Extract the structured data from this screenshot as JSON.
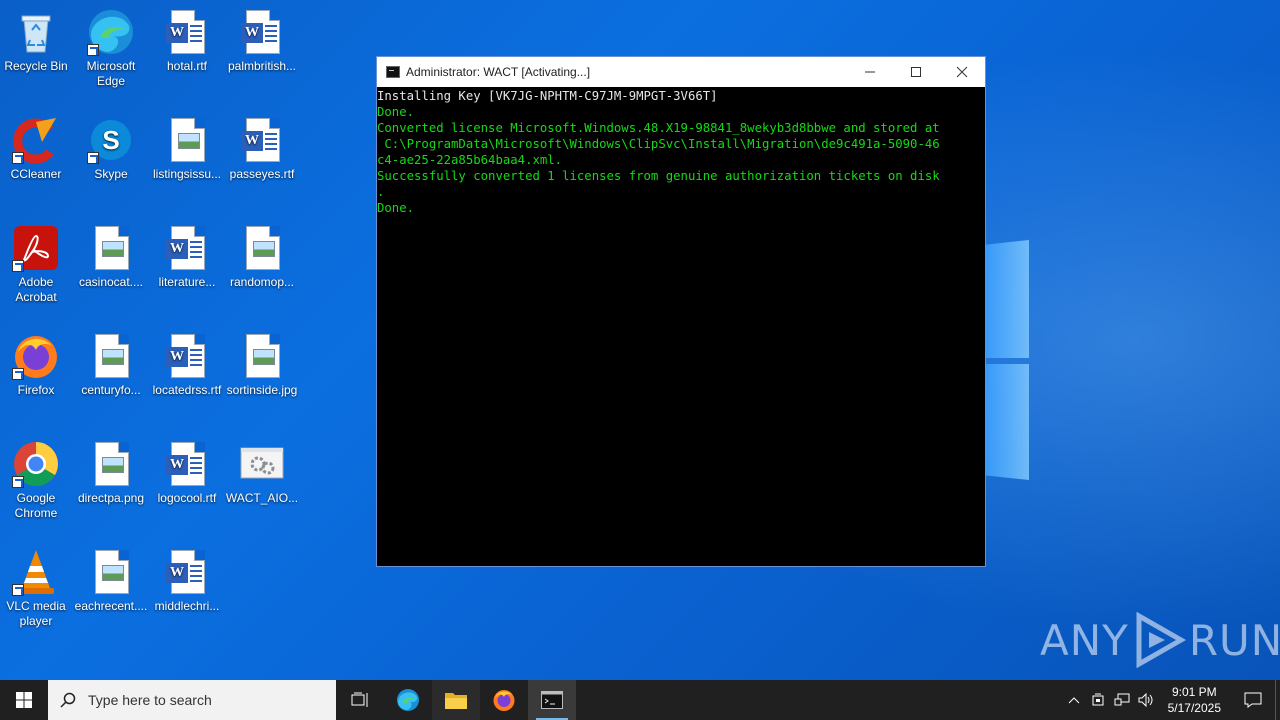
{
  "desktop": {
    "icons": [
      {
        "label": "Recycle Bin",
        "icon": "recycle-bin-icon"
      },
      {
        "label": "Microsoft Edge",
        "icon": "edge-icon"
      },
      {
        "label": "hotal.rtf",
        "icon": "word-doc-icon"
      },
      {
        "label": "palmbritish...",
        "icon": "word-doc-icon"
      },
      {
        "label": "CCleaner",
        "icon": "ccleaner-icon"
      },
      {
        "label": "Skype",
        "icon": "skype-icon"
      },
      {
        "label": "listingsissu...",
        "icon": "image-file-icon"
      },
      {
        "label": "passeyes.rtf",
        "icon": "word-doc-icon"
      },
      {
        "label": "Adobe Acrobat",
        "icon": "acrobat-icon"
      },
      {
        "label": "casinocat....",
        "icon": "image-file-icon"
      },
      {
        "label": "literature...",
        "icon": "word-doc-icon"
      },
      {
        "label": "randomop...",
        "icon": "image-file-icon"
      },
      {
        "label": "Firefox",
        "icon": "firefox-icon"
      },
      {
        "label": "centuryfo...",
        "icon": "image-file-icon"
      },
      {
        "label": "locatedrss.rtf",
        "icon": "word-doc-icon"
      },
      {
        "label": "sortinside.jpg",
        "icon": "image-file-icon"
      },
      {
        "label": "Google Chrome",
        "icon": "chrome-icon"
      },
      {
        "label": "directpa.png",
        "icon": "image-file-icon"
      },
      {
        "label": "logocool.rtf",
        "icon": "word-doc-icon"
      },
      {
        "label": "WACT_AIO...",
        "icon": "settings-file-icon"
      },
      {
        "label": "VLC media player",
        "icon": "vlc-icon"
      },
      {
        "label": "eachrecent....",
        "icon": "image-file-icon"
      },
      {
        "label": "middlechri...",
        "icon": "word-doc-icon"
      }
    ]
  },
  "cmd_window": {
    "title": "Administrator:  WACT [Activating...]",
    "lines": [
      "Installing Key [VK7JG-NPHTM-C97JM-9MPGT-3V66T]",
      "Done.",
      "Converted license Microsoft.Windows.48.X19-98841_8wekyb3d8bbwe and stored at",
      " C:\\ProgramData\\Microsoft\\Windows\\ClipSvc\\Install\\Migration\\de9c491a-5090-46",
      "c4-ae25-22a85b64baa4.xml.",
      "Successfully converted 1 licenses from genuine authorization tickets on disk",
      ".",
      "Done."
    ],
    "line_colors": [
      "#e6e6e6",
      "#16d916",
      "#16d916",
      "#16d916",
      "#16d916",
      "#16d916",
      "#16d916",
      "#16d916"
    ]
  },
  "watermark": {
    "left": "ANY",
    "right": "RUN"
  },
  "taskbar": {
    "search_placeholder": "Type here to search",
    "time": "9:01 PM",
    "date": "5/17/2025"
  }
}
